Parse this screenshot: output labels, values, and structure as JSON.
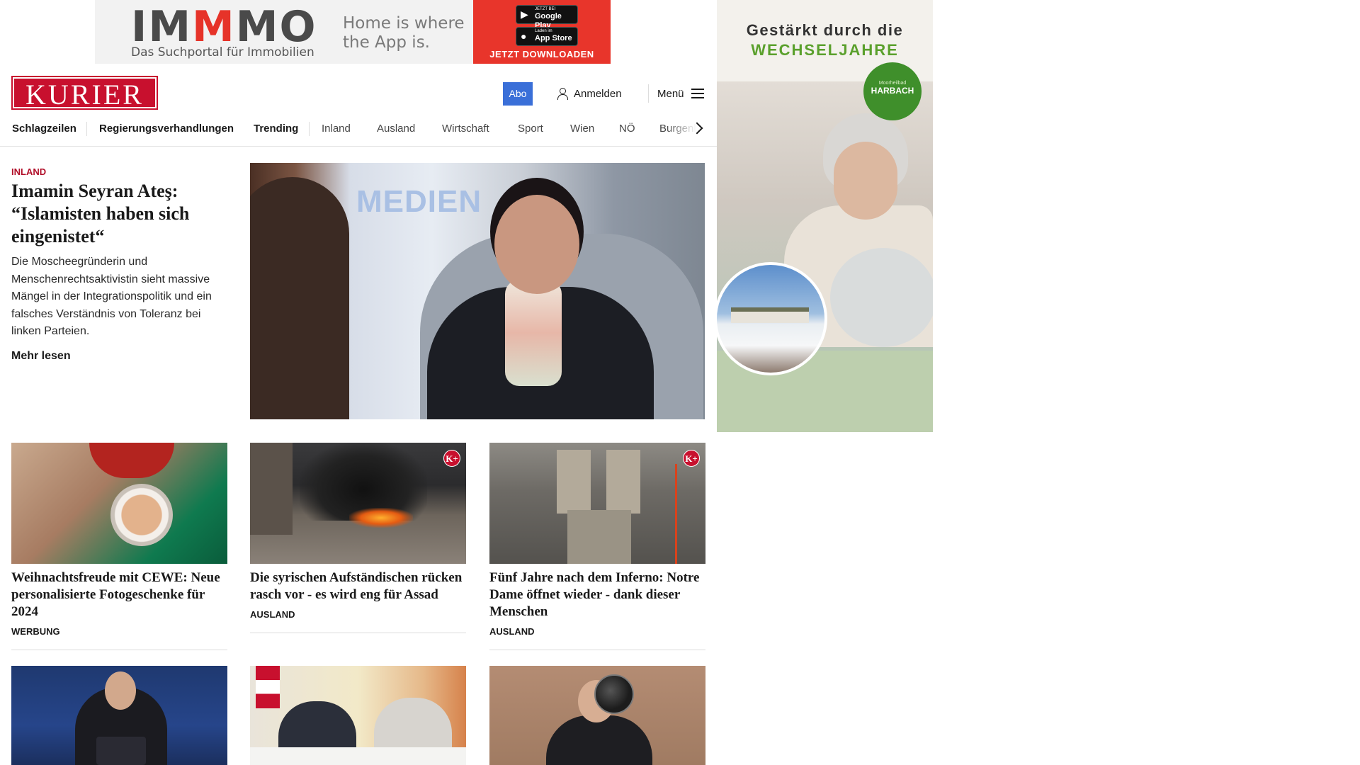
{
  "top_ad": {
    "brand_part1": "IM",
    "brand_part2": "M",
    "brand_part3": "MO",
    "brand_sub": "Das Suchportal für Immobilien",
    "tagline": "Home is where the App is.",
    "google_play_small": "JETZT BEI",
    "google_play_big": "Google Play",
    "app_store_small": "Laden im",
    "app_store_big": "App Store",
    "cta": "JETZT DOWNLOADEN",
    "accent_color": "#e8352b"
  },
  "header": {
    "logo": "KURIER",
    "abo_label": "Abo",
    "login_label": "Anmelden",
    "menu_label": "Menü",
    "brand_color": "#c8102e"
  },
  "nav": {
    "items": [
      "Schlagzeilen",
      "Regierungsverhandlungen",
      "Trending",
      "Inland",
      "Ausland",
      "Wirtschaft",
      "Sport",
      "Wien",
      "NÖ",
      "Burgenl"
    ]
  },
  "hero": {
    "kicker": "INLAND",
    "title": "Imamin Seyran Ateş: “Islamisten haben sich eingenistet“",
    "teaser": "Die Moscheegründerin und Menschenrechtsaktivistin sieht massive Mängel in der Integrationspolitik und ein falsches Verständnis von Toleranz bei linken Parteien.",
    "more_label": "Mehr lesen",
    "image_text": "MEDIEN"
  },
  "cards": [
    {
      "title": "Weihnachtsfreude mit CEWE: Neue personalisierte Fotogeschenke für 2024",
      "label": "WERBUNG",
      "premium": false
    },
    {
      "title": "Die syrischen Aufständischen rücken rasch vor - es wird eng für Assad",
      "label": "AUSLAND",
      "premium": true,
      "badge": "K+"
    },
    {
      "title": "Fünf Jahre nach dem Inferno: Notre Dame öffnet wieder - dank dieser Menschen",
      "label": "AUSLAND",
      "premium": true,
      "badge": "K+"
    }
  ],
  "side_ad": {
    "headline1": "Gestärkt durch die",
    "headline2": "WECHSELJAHRE",
    "badge_small": "Moorheilbad",
    "badge_big": "HARBACH",
    "accent_color": "#5aa02c"
  }
}
